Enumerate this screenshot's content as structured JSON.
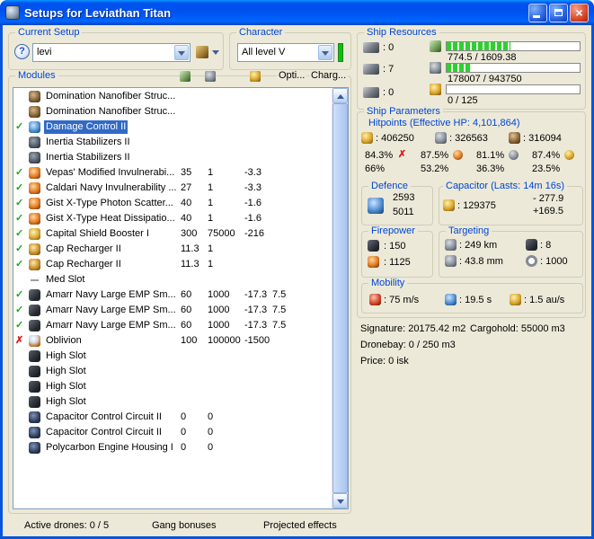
{
  "window": {
    "title": "Setups for Leviathan Titan"
  },
  "current_setup": {
    "title": "Current Setup",
    "combo_value": "levi"
  },
  "character": {
    "title": "Character",
    "combo_value": "All level V"
  },
  "modules": {
    "title": "Modules",
    "header": {
      "opti": "Opti...",
      "charg": "Charg..."
    },
    "rows": [
      {
        "state": "",
        "icon": "nanofiber",
        "name": "Domination Nanofiber Struc...",
        "v": [
          "",
          "",
          "",
          ""
        ]
      },
      {
        "state": "",
        "icon": "nanofiber",
        "name": "Domination Nanofiber Struc...",
        "v": [
          "",
          "",
          "",
          ""
        ]
      },
      {
        "state": "ok",
        "icon": "damage-control",
        "name": "Damage Control II",
        "v": [
          "",
          "",
          "",
          ""
        ],
        "selected": true
      },
      {
        "state": "",
        "icon": "inertia",
        "name": "Inertia Stabilizers II",
        "v": [
          "",
          "",
          "",
          ""
        ]
      },
      {
        "state": "",
        "icon": "inertia",
        "name": "Inertia Stabilizers II",
        "v": [
          "",
          "",
          "",
          ""
        ]
      },
      {
        "state": "ok",
        "icon": "hardener",
        "name": "Vepas' Modified Invulnerabi...",
        "v": [
          "35",
          "1",
          "-3.3",
          ""
        ]
      },
      {
        "state": "ok",
        "icon": "hardener",
        "name": "Caldari Navy Invulnerability ...",
        "v": [
          "27",
          "1",
          "-3.3",
          ""
        ]
      },
      {
        "state": "ok",
        "icon": "hardener",
        "name": "Gist X-Type Photon Scatter...",
        "v": [
          "40",
          "1",
          "-1.6",
          ""
        ]
      },
      {
        "state": "ok",
        "icon": "hardener",
        "name": "Gist X-Type Heat Dissipatio...",
        "v": [
          "40",
          "1",
          "-1.6",
          ""
        ]
      },
      {
        "state": "ok",
        "icon": "booster",
        "name": "Capital Shield Booster I",
        "v": [
          "300",
          "75000",
          "-216",
          ""
        ]
      },
      {
        "state": "ok",
        "icon": "recharger",
        "name": "Cap Recharger II",
        "v": [
          "11.3",
          "1",
          "",
          ""
        ]
      },
      {
        "state": "ok",
        "icon": "recharger",
        "name": "Cap Recharger II",
        "v": [
          "11.3",
          "1",
          "",
          ""
        ]
      },
      {
        "state": "",
        "icon": "empty-med",
        "name": "Med Slot",
        "v": [
          "",
          "",
          "",
          ""
        ]
      },
      {
        "state": "ok",
        "icon": "turret",
        "name": "Amarr Navy Large EMP Sm...",
        "v": [
          "60",
          "1000",
          "-17.3",
          "7.5"
        ]
      },
      {
        "state": "ok",
        "icon": "turret",
        "name": "Amarr Navy Large EMP Sm...",
        "v": [
          "60",
          "1000",
          "-17.3",
          "7.5"
        ]
      },
      {
        "state": "ok",
        "icon": "turret",
        "name": "Amarr Navy Large EMP Sm...",
        "v": [
          "60",
          "1000",
          "-17.3",
          "7.5"
        ]
      },
      {
        "state": "fail",
        "icon": "missile",
        "name": "Oblivion",
        "v": [
          "100",
          "100000",
          "-1500",
          ""
        ]
      },
      {
        "state": "",
        "icon": "highslot",
        "name": "High Slot",
        "v": [
          "",
          "",
          "",
          ""
        ]
      },
      {
        "state": "",
        "icon": "highslot",
        "name": "High Slot",
        "v": [
          "",
          "",
          "",
          ""
        ]
      },
      {
        "state": "",
        "icon": "highslot",
        "name": "High Slot",
        "v": [
          "",
          "",
          "",
          ""
        ]
      },
      {
        "state": "",
        "icon": "highslot",
        "name": "High Slot",
        "v": [
          "",
          "",
          "",
          ""
        ]
      },
      {
        "state": "",
        "icon": "rig",
        "name": "Capacitor Control Circuit II",
        "v": [
          "0",
          "0",
          "",
          ""
        ]
      },
      {
        "state": "",
        "icon": "rig",
        "name": "Capacitor Control Circuit II",
        "v": [
          "0",
          "0",
          "",
          ""
        ]
      },
      {
        "state": "",
        "icon": "rig",
        "name": "Polycarbon Engine Housing I",
        "v": [
          "0",
          "0",
          "",
          ""
        ]
      }
    ]
  },
  "ship_resources": {
    "title": "Ship Resources",
    "turrets": ": 0",
    "launchers": ": 7",
    "drones": ": 0",
    "cpu": {
      "text": "774.5 / 1609.38",
      "pct": 48
    },
    "powergrid": {
      "text": "178007 / 943750",
      "pct": 19
    },
    "calibration": {
      "text": "0 / 125",
      "pct": 0
    }
  },
  "ship_parameters": {
    "title": "Ship Parameters",
    "hitpoints_title": "Hitpoints (Effective HP: 4,101,864)",
    "hp": {
      "shield": ": 406250",
      "armor": ": 326563",
      "structure": ": 316094"
    },
    "resists": [
      {
        "shield": "84.3%",
        "armor": "66%"
      },
      {
        "shield": "87.5%",
        "armor": "53.2%"
      },
      {
        "shield": "81.1%",
        "armor": "36.3%"
      },
      {
        "shield": "87.4%",
        "armor": "23.5%"
      }
    ],
    "defence": {
      "title": "Defence",
      "top": "2593",
      "bottom": "5011"
    },
    "capacitor": {
      "title": "Capacitor (Lasts: 14m 16s)",
      "amount": ": 129375",
      "drain": "- 277.9",
      "recharge": "+169.5"
    },
    "firepower": {
      "title": "Firepower",
      "dps": ": 150",
      "volley": ": 1125"
    },
    "targeting": {
      "title": "Targeting",
      "range": ": 249 km",
      "max_targets": ": 8",
      "scan_res": ": 43.8 mm",
      "sensor": ": 1000"
    },
    "mobility": {
      "title": "Mobility",
      "speed": ": 75 m/s",
      "align": ": 19.5 s",
      "warp": ": 1.5 au/s"
    },
    "signature": "Signature: 20175.42 m2",
    "cargohold": "Cargohold: 55000 m3",
    "dronebay": "Dronebay: 0 / 250 m3",
    "price": "Price: 0 isk"
  },
  "bottom": {
    "active_drones": "Active drones: 0 / 5",
    "gang_bonuses": "Gang bonuses",
    "projected_effects": "Projected effects"
  }
}
